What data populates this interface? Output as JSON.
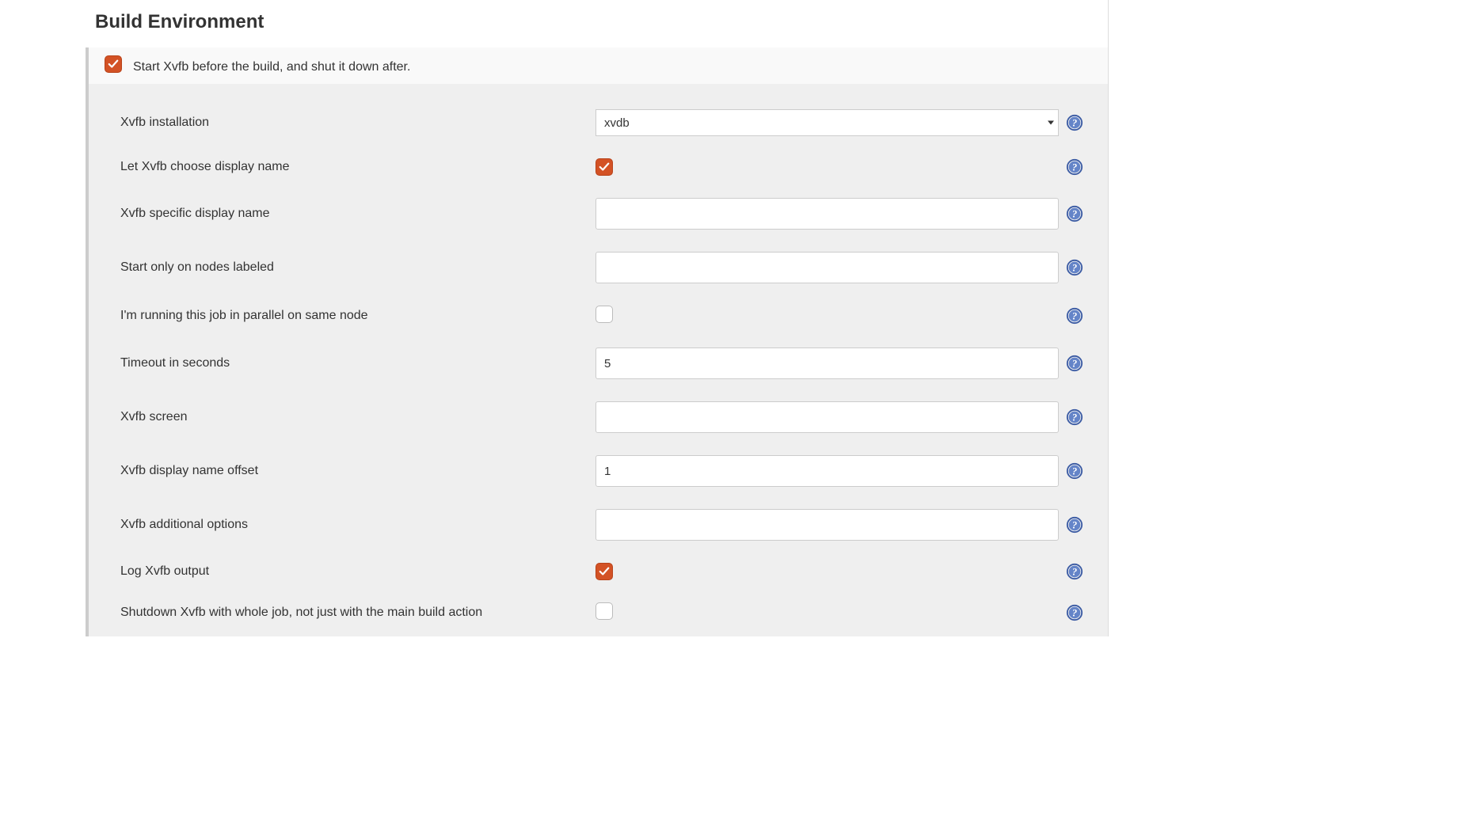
{
  "section": {
    "title": "Build Environment"
  },
  "mainOption": {
    "label": "Start Xvfb before the build, and shut it down after.",
    "checked": true
  },
  "fields": {
    "xvfbInstallation": {
      "label": "Xvfb installation",
      "value": "xvdb"
    },
    "chooseDisplayName": {
      "label": "Let Xvfb choose display name",
      "checked": true
    },
    "specificDisplayName": {
      "label": "Xvfb specific display name",
      "value": ""
    },
    "nodesLabeled": {
      "label": "Start only on nodes labeled",
      "value": ""
    },
    "parallelSameNode": {
      "label": "I'm running this job in parallel on same node",
      "checked": false
    },
    "timeoutSeconds": {
      "label": "Timeout in seconds",
      "value": "5"
    },
    "xvfbScreen": {
      "label": "Xvfb screen",
      "value": ""
    },
    "displayNameOffset": {
      "label": "Xvfb display name offset",
      "value": "1"
    },
    "additionalOptions": {
      "label": "Xvfb additional options",
      "value": ""
    },
    "logOutput": {
      "label": "Log Xvfb output",
      "checked": true
    },
    "shutdownWholeJob": {
      "label": "Shutdown Xvfb with whole job, not just with the main build action",
      "checked": false
    }
  }
}
